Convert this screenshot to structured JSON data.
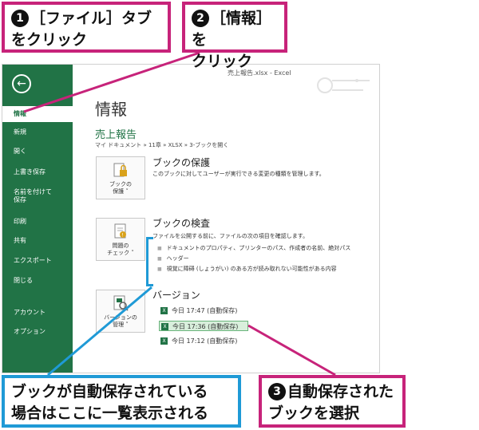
{
  "callouts": {
    "c1": {
      "num": "1",
      "line1": "［ファイル］タブ",
      "line2": "をクリック"
    },
    "c2": {
      "num": "2",
      "line1": "［情報］を",
      "line2": "クリック"
    },
    "c3": {
      "line1": "ブックが自動保存されている",
      "line2": "場合はここに一覧表示される"
    },
    "c4": {
      "num": "3",
      "line1": "自動保存された",
      "line2": "ブックを選択"
    }
  },
  "window": {
    "title": "売上報告.xlsx - Excel"
  },
  "sidebar": {
    "back_label": "←",
    "items": [
      {
        "label": "情報"
      },
      {
        "label": "新規"
      },
      {
        "label": "開く"
      },
      {
        "label": "上書き保存"
      },
      {
        "label": "名前を付けて",
        "label2": "保存"
      },
      {
        "label": "印刷"
      },
      {
        "label": "共有"
      },
      {
        "label": "エクスポート"
      },
      {
        "label": "閉じる"
      },
      {
        "label": "アカウント"
      },
      {
        "label": "オプション"
      }
    ]
  },
  "main": {
    "title": "情報",
    "doc_name": "売上報告",
    "doc_path": "マイ ドキュメント » 11章 » XLSX » 3-ブックを開く",
    "protect": {
      "btn_line1": "ブックの",
      "btn_line2": "保護 ˅",
      "title": "ブックの保護",
      "desc": "このブックに対してユーザーが実行できる変更の種類を管理します。"
    },
    "inspect": {
      "btn_line1": "問題の",
      "btn_line2": "チェック ˅",
      "title": "ブックの検査",
      "desc": "ファイルを公開する前に、ファイルの次の項目を確認します。",
      "bullets": [
        "ドキュメントのプロパティ、プリンターのパス、作成者の名前、絶対パス",
        "ヘッダー",
        "視覚に障碍 (しょうがい) のある方が読み取れない可能性がある内容"
      ]
    },
    "versions": {
      "btn_line1": "バージョンの",
      "btn_line2": "管理 ˅",
      "title": "バージョン",
      "items": [
        {
          "label": "今日 17:47 (自動保存)"
        },
        {
          "label": "今日 17:36 (自動保存)"
        },
        {
          "label": "今日 17:12 (自動保存)"
        }
      ],
      "selected_index": 1
    }
  },
  "colors": {
    "accent": "#217346",
    "callout_border": "#c7237a",
    "blue_callout": "#1f9ad6"
  }
}
